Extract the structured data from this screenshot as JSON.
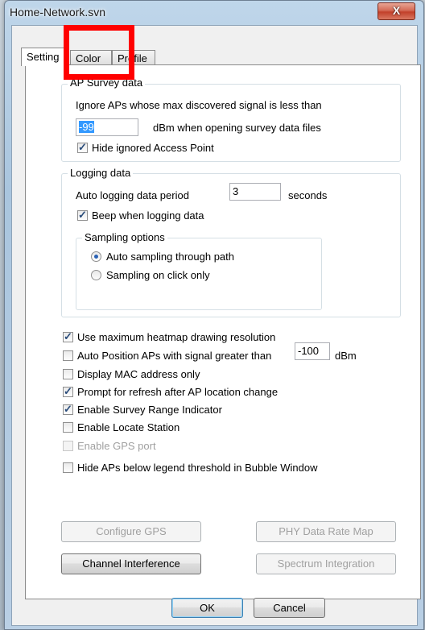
{
  "window": {
    "title": "Home-Network.svn",
    "close_label": "X"
  },
  "tabs": [
    {
      "label": "Setting",
      "active": true
    },
    {
      "label": "Color",
      "active": false
    },
    {
      "label": "Profile",
      "active": false
    }
  ],
  "ap_survey": {
    "legend": "AP Survey data",
    "ignore_text": "Ignore APs whose max discovered signal is less than",
    "threshold_value": "-99",
    "dbm_text": "dBm when opening survey data files",
    "hide_ignored_label": "Hide ignored Access Point",
    "hide_ignored_checked": true
  },
  "logging": {
    "legend": "Logging data",
    "period_label": "Auto logging data period",
    "period_value": "3",
    "seconds_label": "seconds",
    "beep_label": "Beep when logging data",
    "beep_checked": true,
    "sampling": {
      "legend": "Sampling options",
      "auto_label": "Auto sampling through path",
      "auto_selected": true,
      "click_label": "Sampling on click only",
      "click_selected": false
    }
  },
  "options": {
    "max_heatmap_label": "Use maximum heatmap drawing resolution",
    "max_heatmap_checked": true,
    "auto_position_label": "Auto Position APs with signal greater than",
    "auto_position_checked": false,
    "auto_position_value": "-100",
    "auto_position_unit": "dBm",
    "display_mac_label": "Display MAC address only",
    "display_mac_checked": false,
    "prompt_refresh_label": "Prompt for refresh after AP location change",
    "prompt_refresh_checked": true,
    "survey_range_label": "Enable Survey Range Indicator",
    "survey_range_checked": true,
    "locate_station_label": "Enable Locate Station",
    "locate_station_checked": false,
    "gps_port_label": "Enable GPS port",
    "gps_port_checked": false,
    "hide_below_label": "Hide APs below legend threshold in Bubble Window",
    "hide_below_checked": false
  },
  "buttons": {
    "configure_gps": "Configure GPS",
    "phy_rate_map": "PHY Data Rate Map",
    "channel_interference": "Channel Interference",
    "spectrum_integration": "Spectrum Integration",
    "ok": "OK",
    "cancel": "Cancel"
  },
  "colors": {
    "highlight": "#ff0000",
    "selection": "#3399ff"
  }
}
